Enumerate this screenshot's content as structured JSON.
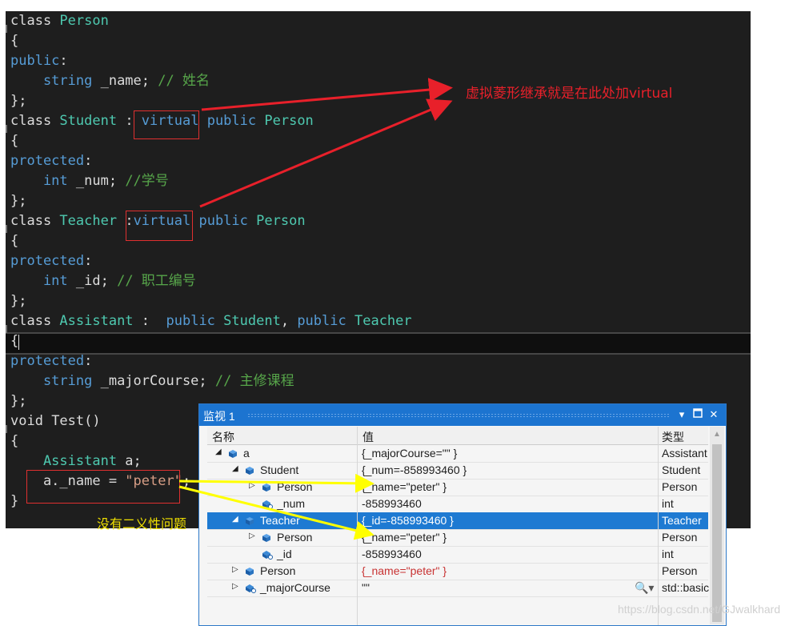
{
  "code": {
    "lines": [
      [
        [
          "id",
          "class "
        ],
        [
          "ty",
          "Person"
        ]
      ],
      [
        [
          "id",
          "{"
        ]
      ],
      [
        [
          "kw",
          "public"
        ],
        [
          "id",
          ":"
        ]
      ],
      [
        [
          "kw",
          "    string"
        ],
        [
          "id",
          " _name; "
        ],
        [
          "cm",
          "// 姓名"
        ]
      ],
      [
        [
          "id",
          "};"
        ]
      ],
      [
        [
          "id",
          "class "
        ],
        [
          "ty",
          "Student"
        ],
        [
          "id",
          " : "
        ],
        [
          "kw",
          "virtual"
        ],
        [
          "id",
          " "
        ],
        [
          "kw",
          "public"
        ],
        [
          "id",
          " "
        ],
        [
          "ty",
          "Person"
        ]
      ],
      [
        [
          "id",
          "{"
        ]
      ],
      [
        [
          "kw",
          "protected"
        ],
        [
          "id",
          ":"
        ]
      ],
      [
        [
          "kw",
          "    int"
        ],
        [
          "id",
          " _num; "
        ],
        [
          "cm",
          "//学号"
        ]
      ],
      [
        [
          "id",
          "};"
        ]
      ],
      [
        [
          "id",
          "class "
        ],
        [
          "ty",
          "Teacher"
        ],
        [
          "id",
          " :"
        ],
        [
          "kw",
          "virtual"
        ],
        [
          "id",
          " "
        ],
        [
          "kw",
          "public"
        ],
        [
          "id",
          " "
        ],
        [
          "ty",
          "Person"
        ]
      ],
      [
        [
          "id",
          "{"
        ]
      ],
      [
        [
          "kw",
          "protected"
        ],
        [
          "id",
          ":"
        ]
      ],
      [
        [
          "kw",
          "    int"
        ],
        [
          "id",
          " _id; "
        ],
        [
          "cm",
          "// 职工编号"
        ]
      ],
      [
        [
          "id",
          "};"
        ]
      ],
      [
        [
          "id",
          "class "
        ],
        [
          "ty",
          "Assistant"
        ],
        [
          "id",
          " :  "
        ],
        [
          "kw",
          "public"
        ],
        [
          "id",
          " "
        ],
        [
          "ty",
          "Student"
        ],
        [
          "id",
          ", "
        ],
        [
          "kw",
          "public"
        ],
        [
          "id",
          " "
        ],
        [
          "ty",
          "Teacher"
        ]
      ],
      [
        [
          "id",
          "{"
        ]
      ],
      [
        [
          "kw",
          "protected"
        ],
        [
          "id",
          ":"
        ]
      ],
      [
        [
          "kw",
          "    string"
        ],
        [
          "id",
          " _majorCourse; "
        ],
        [
          "cm",
          "// 主修课程"
        ]
      ],
      [
        [
          "id",
          "};"
        ]
      ],
      [
        [
          "id",
          "void "
        ],
        [
          "id",
          "Test()"
        ]
      ],
      [
        [
          "id",
          "{"
        ]
      ],
      [
        [
          "ty",
          "    Assistant"
        ],
        [
          "id",
          " a;"
        ]
      ],
      [
        [
          "id",
          "    a._name = "
        ],
        [
          "st",
          "\"peter\""
        ],
        [
          "id",
          ";"
        ]
      ],
      [
        [
          "id",
          "}"
        ]
      ]
    ]
  },
  "annotations": {
    "virtual_note": "虚拟菱形继承就是在此处加virtual",
    "ambiguity_note": "没有二义性问题"
  },
  "watch": {
    "title": "监视 1",
    "headers": {
      "name": "名称",
      "value": "值",
      "type": "类型"
    },
    "rows": [
      {
        "name": "a",
        "value": "{_majorCourse=\"\" }",
        "type": "Assistant",
        "expander": "open"
      },
      {
        "name": "Student",
        "value": "{_num=-858993460 }",
        "type": "Student",
        "expander": "open"
      },
      {
        "name": "Person",
        "value": "{_name=\"peter\" }",
        "type": "Person",
        "expander": "closed"
      },
      {
        "name": "_num",
        "value": "-858993460",
        "type": "int",
        "expander": "none"
      },
      {
        "name": "Teacher",
        "value": "{_id=-858993460 }",
        "type": "Teacher",
        "expander": "open"
      },
      {
        "name": "Person",
        "value": "{_name=\"peter\" }",
        "type": "Person",
        "expander": "closed"
      },
      {
        "name": "_id",
        "value": "-858993460",
        "type": "int",
        "expander": "none"
      },
      {
        "name": "Person",
        "value": "{_name=\"peter\" }",
        "type": "Person",
        "expander": "closed"
      },
      {
        "name": "_majorCourse",
        "value": "\"\"",
        "type": "std::basic",
        "expander": "closed"
      }
    ],
    "selected_row": 4,
    "changed_row": 7
  },
  "watermark": "https://blog.csdn.net/GJwalkhard",
  "colors": {
    "editor_bg": "#1e1e1e",
    "keyword": "#569cd6",
    "type": "#4ec9b0",
    "comment": "#57a64a",
    "string": "#d69d85",
    "annotation_red": "#e8202a",
    "annotation_yellow": "#f0e000",
    "watch_accent": "#1c74d0"
  },
  "icons": [
    "fold-marker-icon",
    "expand-triangle-icon",
    "collapse-triangle-icon",
    "class-cube-icon",
    "field-icon",
    "search-icon",
    "dropdown-icon",
    "maximize-icon",
    "close-icon"
  ]
}
